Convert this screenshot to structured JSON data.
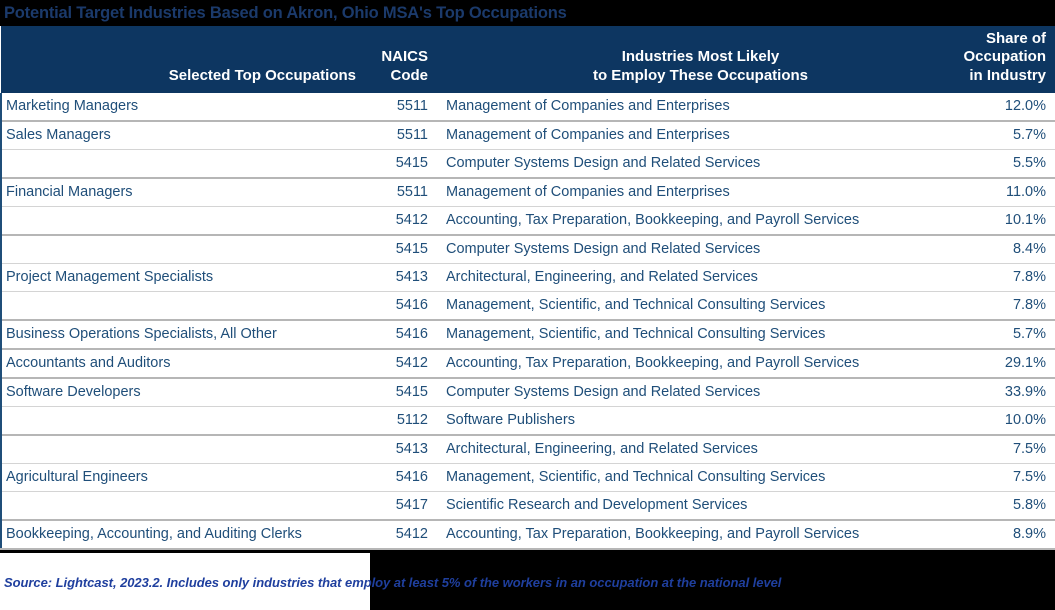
{
  "title": "Potential Target Industries Based on Akron, Ohio MSA's Top Occupations",
  "colors": {
    "header_background": "#0d3661",
    "header_text": "#ffffff",
    "title_text": "#1b3a6b",
    "page_background": "#000000",
    "body_text": "#1f4e79",
    "source_text": "#1f3f9e",
    "row_rule": "#d4d4d4",
    "group_rule": "#b6b6b6"
  },
  "header": {
    "occupation": "Selected Top Occupations",
    "naics_line1": "NAICS",
    "naics_line2": "Code",
    "industry_line1": "Industries Most Likely",
    "industry_line2": "to Employ These Occupations",
    "share_line1": "Share of",
    "share_line2": "Occupation",
    "share_line3": "in Industry"
  },
  "rows": [
    {
      "occupation": "Marketing Managers",
      "naics": "5511",
      "industry": "Management of Companies and Enterprises",
      "share": "12.0%",
      "group_start": true
    },
    {
      "occupation": "Sales Managers",
      "naics": "5511",
      "industry": "Management of Companies and Enterprises",
      "share": "5.7%",
      "group_start": true
    },
    {
      "occupation": "",
      "naics": "5415",
      "industry": "Computer Systems Design and Related Services",
      "share": "5.5%",
      "group_start": false
    },
    {
      "occupation": "Financial Managers",
      "naics": "5511",
      "industry": "Management of Companies and Enterprises",
      "share": "11.0%",
      "group_start": true
    },
    {
      "occupation": "",
      "naics": "5412",
      "industry": "Accounting, Tax Preparation, Bookkeeping, and Payroll Services",
      "share": "10.1%",
      "group_start": false
    },
    {
      "occupation": "",
      "naics": "5415",
      "industry": "Computer Systems Design and Related Services",
      "share": "8.4%",
      "group_start": true
    },
    {
      "occupation": "Project Management Specialists",
      "naics": "5413",
      "industry": "Architectural, Engineering, and Related Services",
      "share": "7.8%",
      "group_start": false
    },
    {
      "occupation": "",
      "naics": "5416",
      "industry": "Management, Scientific, and Technical Consulting Services",
      "share": "7.8%",
      "group_start": false
    },
    {
      "occupation": "Business Operations Specialists, All Other",
      "naics": "5416",
      "industry": "Management, Scientific, and Technical Consulting Services",
      "share": "5.7%",
      "group_start": true
    },
    {
      "occupation": "Accountants and Auditors",
      "naics": "5412",
      "industry": "Accounting, Tax Preparation, Bookkeeping, and Payroll Services",
      "share": "29.1%",
      "group_start": true
    },
    {
      "occupation": "Software Developers",
      "naics": "5415",
      "industry": "Computer Systems Design and Related Services",
      "share": "33.9%",
      "group_start": true
    },
    {
      "occupation": "",
      "naics": "5112",
      "industry": "Software Publishers",
      "share": "10.0%",
      "group_start": false
    },
    {
      "occupation": "",
      "naics": "5413",
      "industry": "Architectural, Engineering, and Related Services",
      "share": "7.5%",
      "group_start": true
    },
    {
      "occupation": "Agricultural Engineers",
      "naics": "5416",
      "industry": "Management, Scientific, and Technical Consulting Services",
      "share": "7.5%",
      "group_start": false
    },
    {
      "occupation": "",
      "naics": "5417",
      "industry": "Scientific Research and Development Services",
      "share": "5.8%",
      "group_start": false
    },
    {
      "occupation": "Bookkeeping, Accounting, and Auditing Clerks",
      "naics": "5412",
      "industry": "Accounting, Tax Preparation, Bookkeeping, and Payroll Services",
      "share": "8.9%",
      "group_start": true
    }
  ],
  "source": "Source: Lightcast, 2023.2. Includes only industries that employ at least 5% of the workers in an occupation at the national level"
}
